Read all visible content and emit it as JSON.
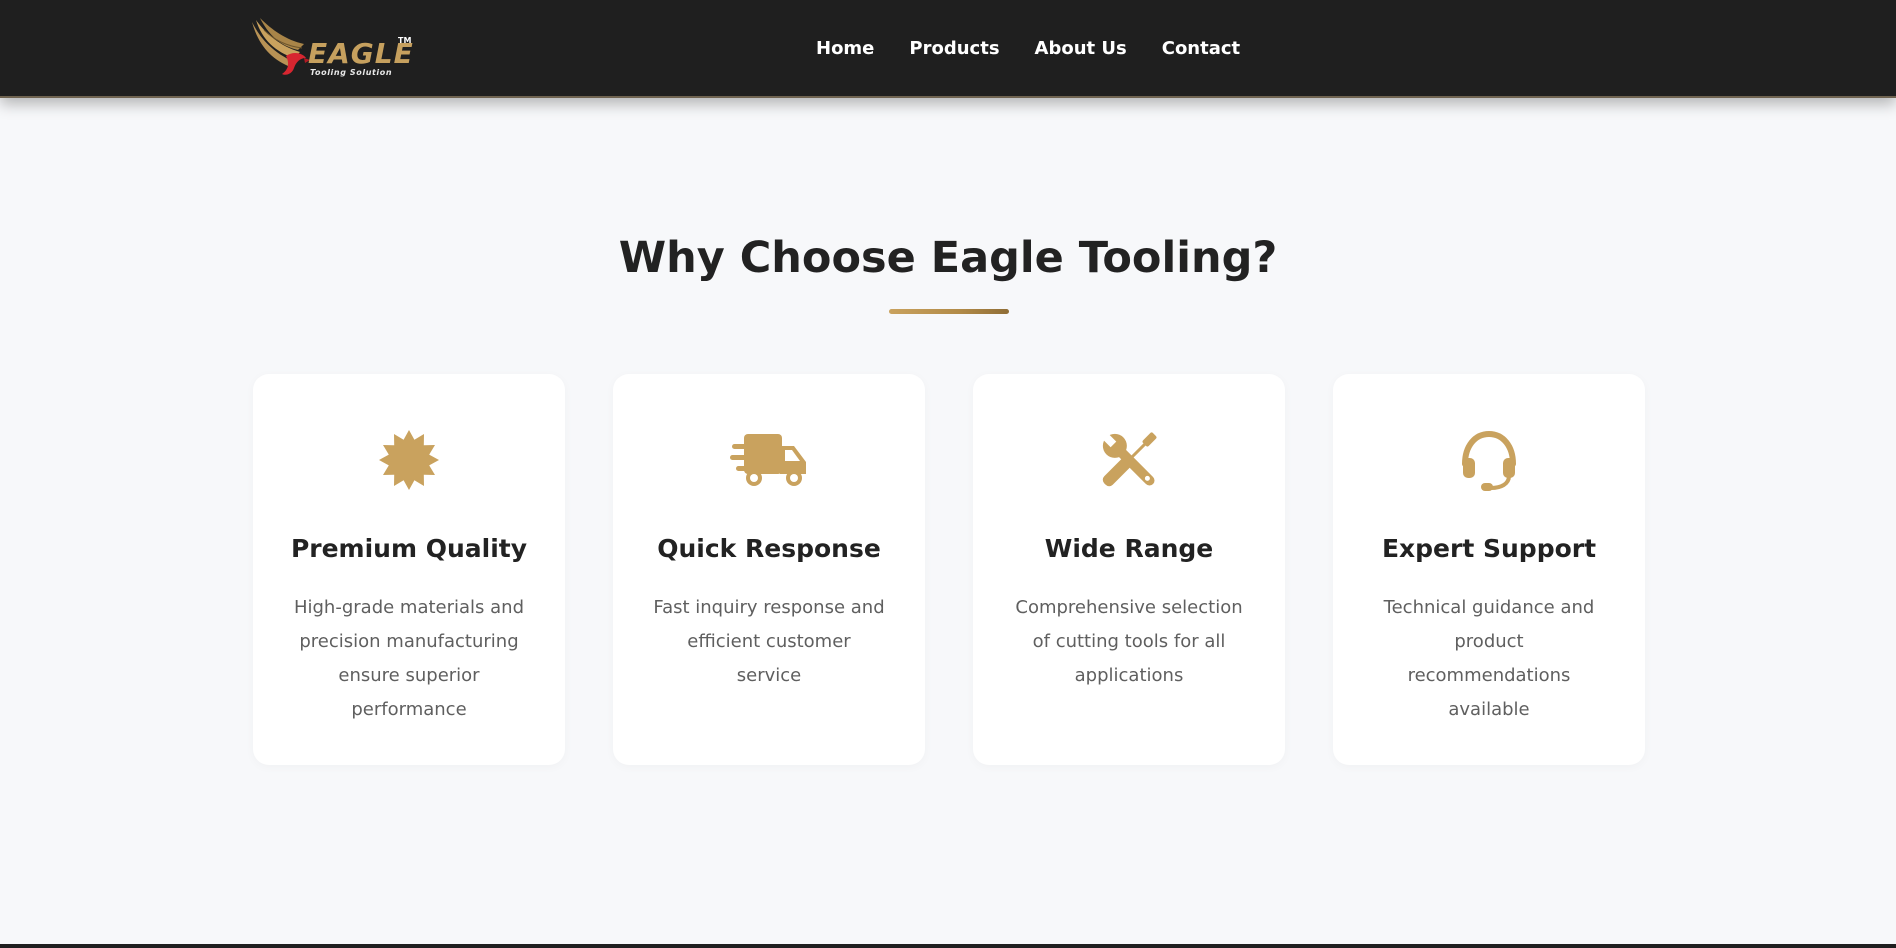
{
  "header": {
    "logo": {
      "word": "EAGLE",
      "tm": "TM",
      "tagline": "Tooling Solution"
    },
    "nav": [
      {
        "label": "Home"
      },
      {
        "label": "Products"
      },
      {
        "label": "About Us"
      },
      {
        "label": "Contact"
      }
    ]
  },
  "main": {
    "title": "Why Choose Eagle Tooling?",
    "cards": [
      {
        "icon": "certificate-icon",
        "title": "Premium Quality",
        "desc": "High-grade materials and precision manufacturing ensure superior performance"
      },
      {
        "icon": "delivery-truck-icon",
        "title": "Quick Response",
        "desc": "Fast inquiry response and efficient customer service"
      },
      {
        "icon": "tools-icon",
        "title": "Wide Range",
        "desc": "Comprehensive selection of cutting tools for all applications"
      },
      {
        "icon": "headset-icon",
        "title": "Expert Support",
        "desc": "Technical guidance and product recommendations available"
      }
    ]
  },
  "colors": {
    "header_bg": "#1f1f1f",
    "page_bg": "#f7f8fa",
    "accent_gold": "#c9a25e",
    "logo_red": "#d72630",
    "title_text": "#222222",
    "body_text": "#5f5f5f"
  }
}
